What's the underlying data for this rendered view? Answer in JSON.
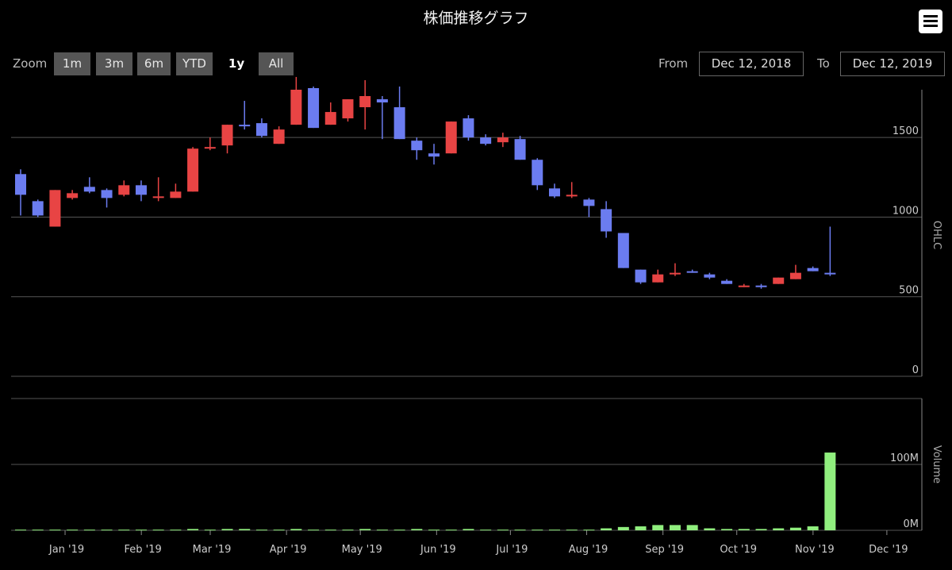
{
  "header": {
    "title": "株価推移グラフ",
    "menu_icon": "hamburger-menu-icon"
  },
  "zoom": {
    "label": "Zoom",
    "buttons": [
      "1m",
      "3m",
      "6m",
      "YTD",
      "1y",
      "All"
    ],
    "selected": "1y"
  },
  "range": {
    "from_label": "From",
    "from_value": "Dec 12, 2018",
    "to_label": "To",
    "to_value": "Dec 12, 2019"
  },
  "colors": {
    "up": "#e84444",
    "down": "#6b7cf0",
    "volume": "#90ee7e",
    "background": "#000000",
    "grid": "#555555"
  },
  "chart_data": [
    {
      "type": "candlestick",
      "ylabel": "OHLC",
      "ylim": [
        0,
        1800
      ],
      "yticks": [
        0,
        500,
        1000,
        1500
      ],
      "xticks": [
        "Jan '19",
        "Feb '19",
        "Mar '19",
        "Apr '19",
        "May '19",
        "Jun '19",
        "Jul '19",
        "Aug '19",
        "Sep '19",
        "Oct '19",
        "Nov '19",
        "Dec '19"
      ],
      "grid": true,
      "candles": [
        {
          "date": "2018-12-12",
          "open": 1270,
          "high": 1300,
          "low": 1010,
          "close": 1140
        },
        {
          "date": "2018-12-19",
          "open": 1100,
          "high": 1110,
          "low": 1000,
          "close": 1010
        },
        {
          "date": "2018-12-26",
          "open": 940,
          "high": 1170,
          "low": 940,
          "close": 1170
        },
        {
          "date": "2019-01-02",
          "open": 1120,
          "high": 1170,
          "low": 1110,
          "close": 1150
        },
        {
          "date": "2019-01-09",
          "open": 1190,
          "high": 1250,
          "low": 1150,
          "close": 1160
        },
        {
          "date": "2019-01-16",
          "open": 1170,
          "high": 1180,
          "low": 1060,
          "close": 1120
        },
        {
          "date": "2019-01-23",
          "open": 1140,
          "high": 1230,
          "low": 1130,
          "close": 1200
        },
        {
          "date": "2019-01-30",
          "open": 1200,
          "high": 1230,
          "low": 1100,
          "close": 1140
        },
        {
          "date": "2019-02-06",
          "open": 1120,
          "high": 1250,
          "low": 1100,
          "close": 1130
        },
        {
          "date": "2019-02-13",
          "open": 1120,
          "high": 1210,
          "low": 1120,
          "close": 1160
        },
        {
          "date": "2019-02-20",
          "open": 1160,
          "high": 1440,
          "low": 1160,
          "close": 1430
        },
        {
          "date": "2019-02-27",
          "open": 1430,
          "high": 1500,
          "low": 1420,
          "close": 1440
        },
        {
          "date": "2019-03-06",
          "open": 1450,
          "high": 1580,
          "low": 1400,
          "close": 1580
        },
        {
          "date": "2019-03-13",
          "open": 1580,
          "high": 1730,
          "low": 1550,
          "close": 1570
        },
        {
          "date": "2019-03-20",
          "open": 1590,
          "high": 1620,
          "low": 1500,
          "close": 1510
        },
        {
          "date": "2019-03-27",
          "open": 1460,
          "high": 1570,
          "low": 1460,
          "close": 1550
        },
        {
          "date": "2019-04-03",
          "open": 1580,
          "high": 1880,
          "low": 1580,
          "close": 1800
        },
        {
          "date": "2019-04-10",
          "open": 1810,
          "high": 1820,
          "low": 1560,
          "close": 1560
        },
        {
          "date": "2019-04-17",
          "open": 1580,
          "high": 1720,
          "low": 1580,
          "close": 1660
        },
        {
          "date": "2019-04-24",
          "open": 1620,
          "high": 1740,
          "low": 1600,
          "close": 1740
        },
        {
          "date": "2019-05-01",
          "open": 1690,
          "high": 1860,
          "low": 1550,
          "close": 1760
        },
        {
          "date": "2019-05-08",
          "open": 1740,
          "high": 1760,
          "low": 1490,
          "close": 1720
        },
        {
          "date": "2019-05-15",
          "open": 1690,
          "high": 1820,
          "low": 1490,
          "close": 1490
        },
        {
          "date": "2019-05-22",
          "open": 1480,
          "high": 1500,
          "low": 1360,
          "close": 1420
        },
        {
          "date": "2019-05-29",
          "open": 1400,
          "high": 1460,
          "low": 1330,
          "close": 1380
        },
        {
          "date": "2019-06-05",
          "open": 1400,
          "high": 1600,
          "low": 1400,
          "close": 1600
        },
        {
          "date": "2019-06-12",
          "open": 1620,
          "high": 1640,
          "low": 1480,
          "close": 1500
        },
        {
          "date": "2019-06-19",
          "open": 1500,
          "high": 1520,
          "low": 1450,
          "close": 1460
        },
        {
          "date": "2019-06-26",
          "open": 1470,
          "high": 1530,
          "low": 1440,
          "close": 1500
        },
        {
          "date": "2019-07-03",
          "open": 1490,
          "high": 1510,
          "low": 1360,
          "close": 1360
        },
        {
          "date": "2019-07-10",
          "open": 1360,
          "high": 1370,
          "low": 1170,
          "close": 1200
        },
        {
          "date": "2019-07-17",
          "open": 1180,
          "high": 1210,
          "low": 1120,
          "close": 1130
        },
        {
          "date": "2019-07-24",
          "open": 1130,
          "high": 1220,
          "low": 1120,
          "close": 1140
        },
        {
          "date": "2019-07-31",
          "open": 1110,
          "high": 1120,
          "low": 1000,
          "close": 1070
        },
        {
          "date": "2019-08-07",
          "open": 1050,
          "high": 1100,
          "low": 870,
          "close": 910
        },
        {
          "date": "2019-08-14",
          "open": 900,
          "high": 900,
          "low": 680,
          "close": 680
        },
        {
          "date": "2019-08-21",
          "open": 670,
          "high": 670,
          "low": 580,
          "close": 590
        },
        {
          "date": "2019-08-28",
          "open": 590,
          "high": 670,
          "low": 590,
          "close": 640
        },
        {
          "date": "2019-09-04",
          "open": 640,
          "high": 710,
          "low": 630,
          "close": 650
        },
        {
          "date": "2019-09-11",
          "open": 660,
          "high": 670,
          "low": 650,
          "close": 650
        },
        {
          "date": "2019-09-18",
          "open": 640,
          "high": 650,
          "low": 610,
          "close": 620
        },
        {
          "date": "2019-09-25",
          "open": 600,
          "high": 610,
          "low": 580,
          "close": 580
        },
        {
          "date": "2019-10-02",
          "open": 570,
          "high": 580,
          "low": 560,
          "close": 570
        },
        {
          "date": "2019-10-09",
          "open": 570,
          "high": 580,
          "low": 550,
          "close": 560
        },
        {
          "date": "2019-10-16",
          "open": 580,
          "high": 620,
          "low": 580,
          "close": 620
        },
        {
          "date": "2019-10-23",
          "open": 610,
          "high": 700,
          "low": 610,
          "close": 650
        },
        {
          "date": "2019-10-30",
          "open": 680,
          "high": 690,
          "low": 660,
          "close": 660
        },
        {
          "date": "2019-11-06",
          "open": 650,
          "high": 940,
          "low": 630,
          "close": 640
        }
      ]
    },
    {
      "type": "bar",
      "ylabel": "Volume",
      "ylim": [
        0,
        200
      ],
      "yticks": [
        0,
        100
      ],
      "ytick_labels": [
        "0M",
        "100M"
      ],
      "grid": true,
      "values": [
        1,
        1,
        1,
        1,
        1,
        1,
        1,
        1,
        1,
        1,
        2,
        1,
        2,
        2,
        1,
        1,
        2,
        1,
        1,
        1,
        2,
        1,
        1,
        2,
        1,
        1,
        2,
        1,
        1,
        1,
        1,
        1,
        1,
        1,
        3,
        5,
        6,
        8,
        8,
        8,
        3,
        2,
        2,
        2,
        3,
        4,
        6,
        118
      ]
    }
  ]
}
